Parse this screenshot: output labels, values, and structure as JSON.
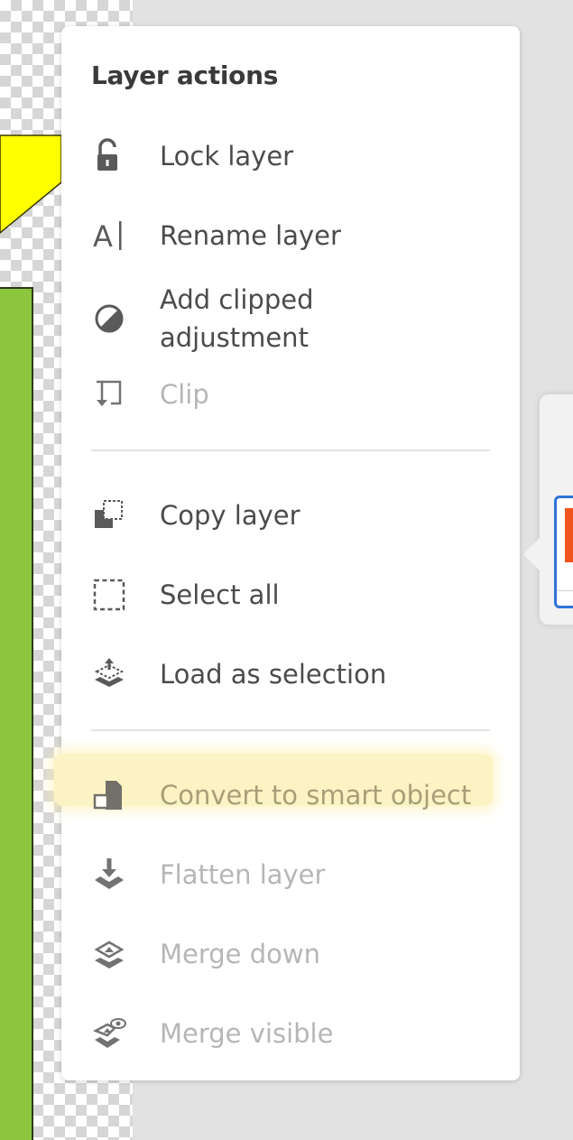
{
  "menu": {
    "title": "Layer actions",
    "items": [
      {
        "label": "Lock layer",
        "icon": "unlock-icon",
        "enabled": true
      },
      {
        "label": "Rename layer",
        "icon": "text-cursor-icon",
        "enabled": true
      },
      {
        "label": "Add clipped\nadjustment",
        "icon": "half-circle-adjustment-icon",
        "enabled": true
      },
      {
        "label": "Clip",
        "icon": "clip-icon",
        "enabled": false
      },
      {
        "label": "Copy layer",
        "icon": "copy-layer-icon",
        "enabled": true
      },
      {
        "label": "Select all",
        "icon": "marquee-select-icon",
        "enabled": true
      },
      {
        "label": "Load as selection",
        "icon": "load-selection-icon",
        "enabled": true
      },
      {
        "label": "Convert to smart object",
        "icon": "smart-object-icon",
        "enabled": false,
        "highlighted": true
      },
      {
        "label": "Flatten layer",
        "icon": "flatten-icon",
        "enabled": false
      },
      {
        "label": "Merge down",
        "icon": "merge-down-icon",
        "enabled": false
      },
      {
        "label": "Merge visible",
        "icon": "merge-visible-icon",
        "enabled": false
      }
    ]
  },
  "colors": {
    "canvas_yellow": "#ffff00",
    "canvas_green": "#8cc63f",
    "selected_layer_border": "#2f73d8",
    "layer_thumb_accent": "#f0541b",
    "highlight": "#fcf3c4"
  }
}
